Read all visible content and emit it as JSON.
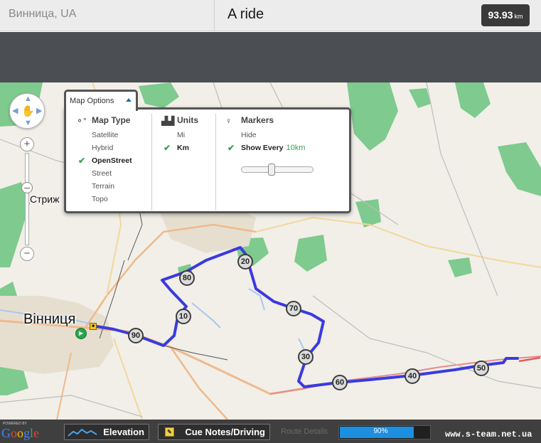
{
  "header": {
    "location": "Винница, UA",
    "title": "A ride",
    "distance_value": "93.93",
    "distance_unit": "km"
  },
  "map": {
    "city_label": "Вінниця",
    "village_label": "Стриж",
    "km_markers": [
      "10",
      "20",
      "30",
      "40",
      "50",
      "60",
      "70",
      "80",
      "90"
    ],
    "route_color": "#3a3ae0"
  },
  "map_options": {
    "tab_label": "Map Options",
    "map_type": {
      "heading": "Map Type",
      "options": [
        "Satellite",
        "Hybrid",
        "OpenStreet",
        "Street",
        "Terrain",
        "Topo"
      ],
      "selected": "OpenStreet"
    },
    "units": {
      "heading": "Units",
      "options": [
        "Mi",
        "Km"
      ],
      "selected": "Km"
    },
    "markers": {
      "heading": "Markers",
      "hide_label": "Hide",
      "show_every_label": "Show Every",
      "show_every_value": "10km",
      "slider_fraction": 0.4
    }
  },
  "bottom_bar": {
    "google_powered": "POWERED BY",
    "google_logo": "Google",
    "elevation_label": "Elevation",
    "cue_label": "Cue Notes/Driving",
    "route_details_label": "Route Details",
    "progress_percent": 90,
    "progress_label": "90%",
    "watermark": "www.s-team.net.ua"
  }
}
